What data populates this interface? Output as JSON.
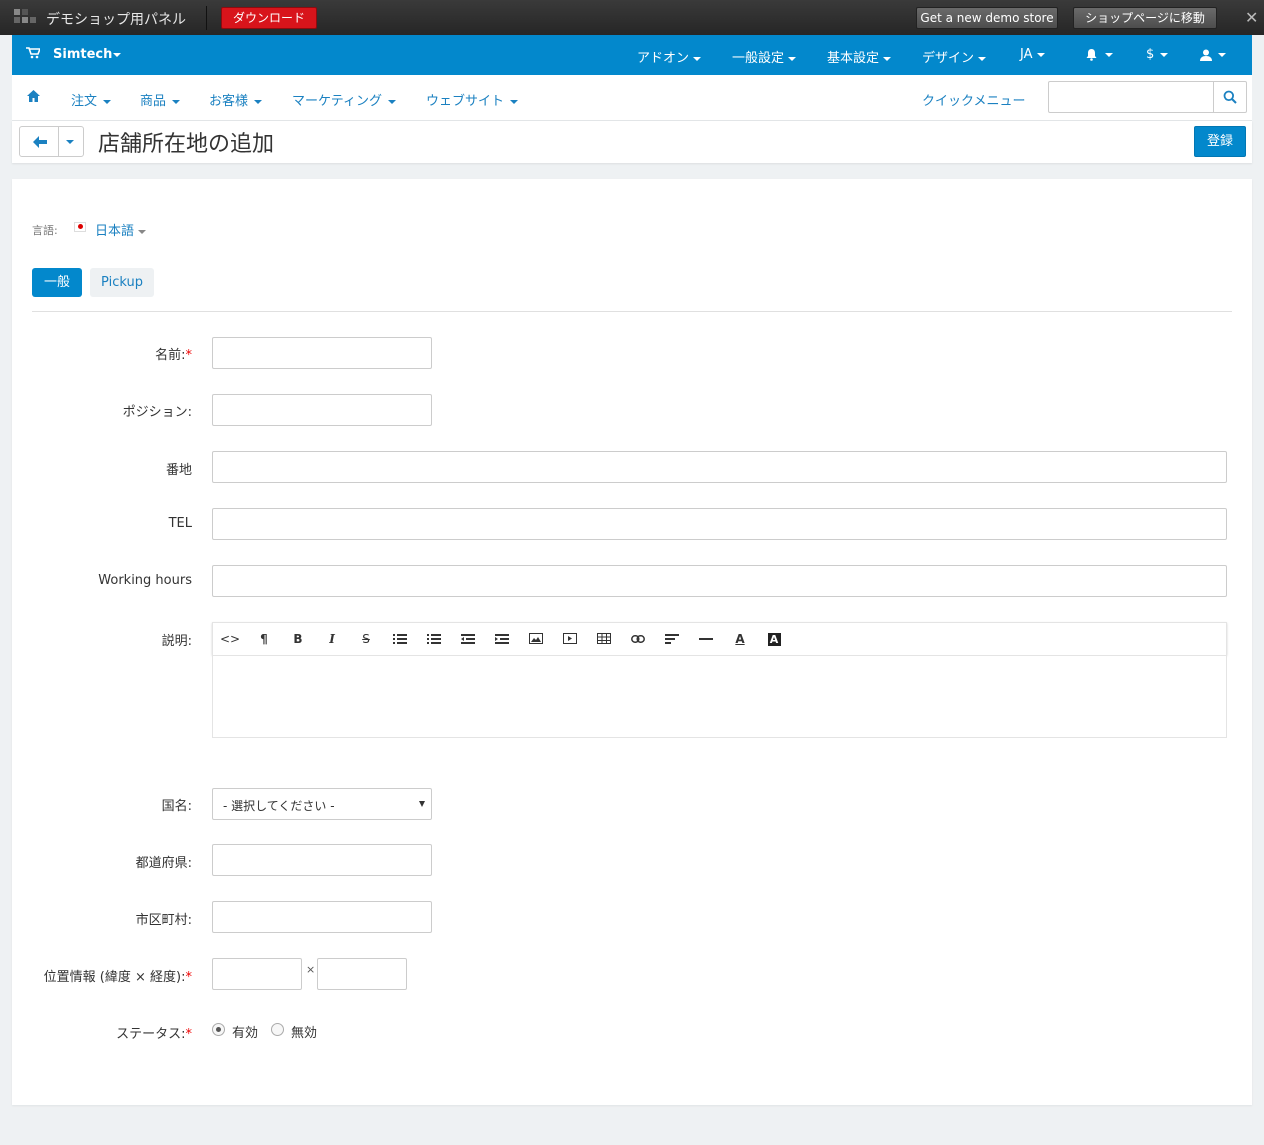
{
  "demo_bar": {
    "title": "デモショップ用パネル",
    "download_label": "ダウンロード",
    "new_demo_label": "Get a new demo store",
    "goto_store_label": "ショップページに移動",
    "close_glyph": "✕"
  },
  "top_nav": {
    "brand": "Simtech",
    "items": [
      "アドオン",
      "一般設定",
      "基本設定",
      "デザイン",
      "JA"
    ],
    "currency": "$"
  },
  "menu": {
    "items": [
      "注文",
      "商品",
      "お客様",
      "マーケティング",
      "ウェブサイト"
    ],
    "quick_menu": "クイックメニュー",
    "search_value": ""
  },
  "page": {
    "title": "店舗所在地の追加",
    "save_label": "登録"
  },
  "language": {
    "label": "言語:",
    "value": "日本語"
  },
  "tabs": [
    "一般",
    "Pickup"
  ],
  "form": {
    "name_label": "名前:",
    "position_label": "ポジション:",
    "address_label": "番地",
    "tel_label": "TEL",
    "hours_label": "Working hours",
    "description_label": "説明:",
    "country_label": "国名:",
    "country_value": "- 選択してください -",
    "state_label": "都道府県:",
    "city_label": "市区町村:",
    "location_label": "位置情報 (緯度 × 経度):",
    "times_glyph": "×",
    "status_label": "ステータス:",
    "status_active": "有効",
    "status_disabled": "無効",
    "required_mark": "*"
  },
  "editor_toolbar": [
    "<>",
    "¶",
    "B",
    "I",
    "S",
    "list",
    "ol",
    "outdent",
    "indent",
    "image",
    "video",
    "table",
    "link",
    "align",
    "hr",
    "A",
    "A"
  ],
  "colors": {
    "primary": "#0388cc",
    "link": "#1b81c1",
    "download": "#d8141b"
  }
}
